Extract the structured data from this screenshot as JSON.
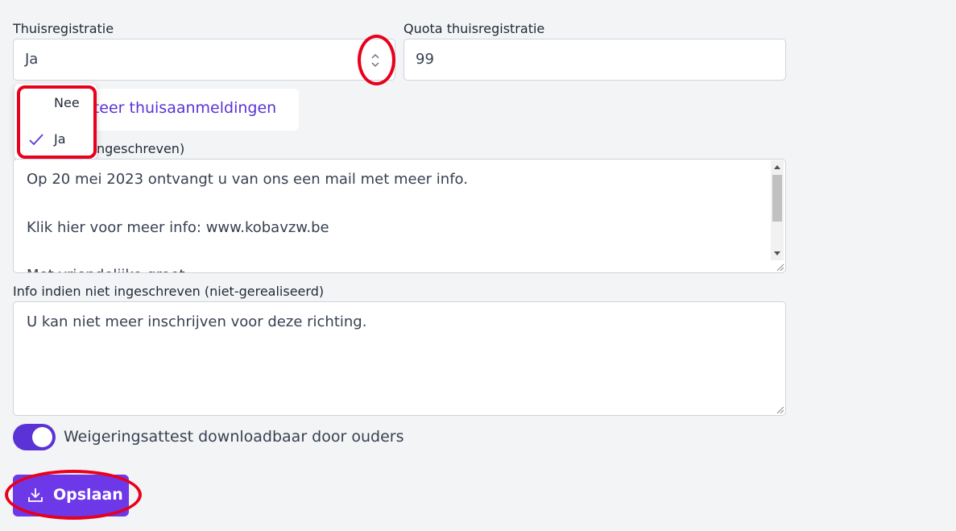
{
  "form": {
    "thuisregistratie": {
      "label": "Thuisregistratie",
      "value": "Ja",
      "options": [
        "Nee",
        "Ja"
      ],
      "selected": "Ja"
    },
    "quota": {
      "label": "Quota thuisregistratie",
      "value": "99"
    },
    "export_button_label": "rteer thuisaanmeldingen",
    "info_ingeschreven": {
      "label": "ngeschreven)",
      "lines": [
        "Op 20 mei 2023 ontvangt u van ons een mail met meer info.",
        "Klik hier voor meer info: www.kobavzw.be",
        "Met vriendelijke groet"
      ]
    },
    "info_niet_ingeschreven": {
      "label": "Info indien niet ingeschreven (niet-gerealiseerd)",
      "value": "U kan niet meer inschrijven voor deze richting."
    },
    "weigeringsattest": {
      "label": "Weigeringsattest downloadbaar door ouders",
      "enabled": true
    },
    "save_button_label": "Opslaan"
  },
  "colors": {
    "accent": "#5b32d6",
    "button": "#6d38e8",
    "annotation": "#e8001c"
  }
}
